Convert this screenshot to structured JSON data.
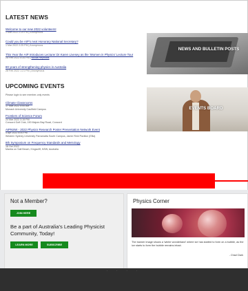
{
  "latest_news": {
    "title": "LATEST NEWS",
    "items": [
      {
        "title": "Welcome to our new 2022 volunteers!",
        "date": "1 Mar 2022 2:29 PM",
        "author": "Anonymous"
      },
      {
        "title": "Could you be AIP's next Honorary National Secretary?",
        "date": "1 Mar 2022 2:25 PM",
        "author": "Anonymous"
      },
      {
        "title": "This Year the AIP Introduces Lecturer Dr Karen Livesey as the 'Women in Physics' Lecture Tour",
        "date": "28 Feb 2022 5:34 PM",
        "author": "Nicola Reynolds"
      },
      {
        "title": "80 years of strengthening physics in Australia",
        "date": "28 Feb 2022 1:21 PM",
        "author": "Anonymous"
      }
    ]
  },
  "upcoming_events": {
    "title": "UPCOMING EVENTS",
    "login_note": "Please login to see member-only events",
    "items": [
      {
        "title": "Climate Classrooms",
        "date": "17 Mar 2022 5:00 AM",
        "location": "Monash University Caulfield Campus"
      },
      {
        "title": "Frontiers of Science Forum",
        "date": "24 Mar 2022 3:15 PM",
        "location": "Concord Golf Club, 190 Majors Bay Road, Concord"
      },
      {
        "title": "AIPNSW - 2022 Physics Research Poster Presentation Network Event",
        "date": "4 Apr 2022 6:00 PM",
        "location": "Western Sydney University Parramatta South Campus, Jamie Reid Pavilion (EBa)"
      },
      {
        "title": "8th Symposium on Frequency Standards and Metrology",
        "date": "16 Oct 2022",
        "location": "Mantra on Salt Beach, Kingscliff, NSW, Australia"
      }
    ]
  },
  "promos": {
    "news": "NEWS AND BULLETIN POSTS",
    "events": "EVENTS BOARD"
  },
  "membership": {
    "title": "Not a Member?",
    "join_label": "JOIN HERE",
    "tagline": "Be a part of Australia's Leading Physicist Community, Today!",
    "learn_label": "LEARN MORE",
    "subscribe_label": "SUBSCRIBE"
  },
  "physics_corner": {
    "title": "Physics Corner",
    "caption": "The banner image shows a 'winter wonderland' where ice has started to form on a bubble, as the ice starts to form the bubble remains intact.",
    "credit": "- Chad Clark"
  },
  "footer": {
    "links": "· · · ·"
  },
  "colors": {
    "link": "#1a2b8f",
    "button_green": "#168a1e",
    "redaction": "#ff0000",
    "footer_bg": "#2f2f2f"
  }
}
